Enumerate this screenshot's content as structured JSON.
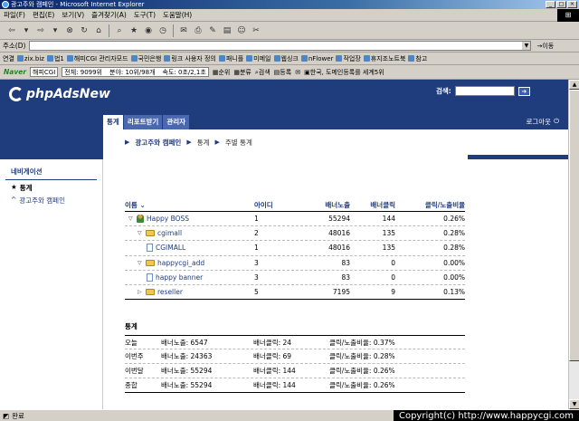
{
  "window": {
    "title": "광고주와 캠페인 - Microsoft Internet Explorer"
  },
  "menu": [
    "파일(F)",
    "편집(E)",
    "보기(V)",
    "즐겨찾기(A)",
    "도구(T)",
    "도움말(H)"
  ],
  "address": {
    "label": "주소(D)",
    "go": "이동"
  },
  "links": {
    "label": "연결",
    "items": [
      "zix.biz",
      "법1",
      "해피CGI 관리자모드",
      "국민은행",
      "링크 사용자 정의",
      "패니플",
      "미메일",
      "웹싱크",
      "nFlower",
      "작업장",
      "휴지조노트북",
      "참고"
    ]
  },
  "naver": {
    "logo": "Naver",
    "search": "해피CGI",
    "stats": [
      "전체: 9099위",
      "분야: 10위/98개",
      "속도: 0초/2,1초"
    ],
    "buttons": [
      "순위",
      "분류",
      "검색",
      "등록"
    ],
    "notice": "한국, 도메인등록를 세계5위"
  },
  "app": {
    "logo": "phpAdsNew",
    "search_label": "검색:",
    "tabs": [
      "통계",
      "리포트받기",
      "관리자"
    ],
    "logout": "로그아웃",
    "breadcrumb": [
      "광고주와 캠페인",
      "통계",
      "주별 통계"
    ]
  },
  "sidenav": {
    "title": "네비게이션",
    "items": [
      "통계",
      "광고주와 캠페인"
    ]
  },
  "table": {
    "headers": [
      "이름",
      "아이디",
      "배너노출",
      "배너클릭",
      "클릭/노출비율"
    ],
    "rows": [
      {
        "name": "Happy BOSS",
        "id": "1",
        "impressions": "55294",
        "clicks": "144",
        "ctr": "0.26%",
        "level": 0,
        "type": "client",
        "expanded": true
      },
      {
        "name": "cgimall",
        "id": "2",
        "impressions": "48016",
        "clicks": "135",
        "ctr": "0.28%",
        "level": 1,
        "type": "campaign",
        "expanded": true
      },
      {
        "name": "CGIMALL",
        "id": "1",
        "impressions": "48016",
        "clicks": "135",
        "ctr": "0.28%",
        "level": 2,
        "type": "banner"
      },
      {
        "name": "happycgi_add",
        "id": "3",
        "impressions": "83",
        "clicks": "0",
        "ctr": "0.00%",
        "level": 1,
        "type": "campaign",
        "expanded": true
      },
      {
        "name": "happy banner",
        "id": "3",
        "impressions": "83",
        "clicks": "0",
        "ctr": "0.00%",
        "level": 2,
        "type": "banner"
      },
      {
        "name": "reseller",
        "id": "5",
        "impressions": "7195",
        "clicks": "9",
        "ctr": "0.13%",
        "level": 1,
        "type": "campaign",
        "expanded": false
      }
    ]
  },
  "stats": {
    "title": "통계",
    "rows": [
      {
        "label": "오늘",
        "imp": "배너노출: 6547",
        "clk": "배너클릭: 24",
        "ctr": "클릭/노출비율: 0.37%"
      },
      {
        "label": "이번주",
        "imp": "배너노출: 24363",
        "clk": "배너클릭: 69",
        "ctr": "클릭/노출비율: 0.28%"
      },
      {
        "label": "이번달",
        "imp": "배너노출: 55294",
        "clk": "배너클릭: 144",
        "ctr": "클릭/노출비율: 0.26%"
      },
      {
        "label": "종합",
        "imp": "배너노출: 55294",
        "clk": "배너클릭: 144",
        "ctr": "클릭/노출비율: 0.26%"
      }
    ]
  },
  "status": {
    "text": "완료",
    "copyright": "Copyright(c) http://www.happycgi.com"
  }
}
